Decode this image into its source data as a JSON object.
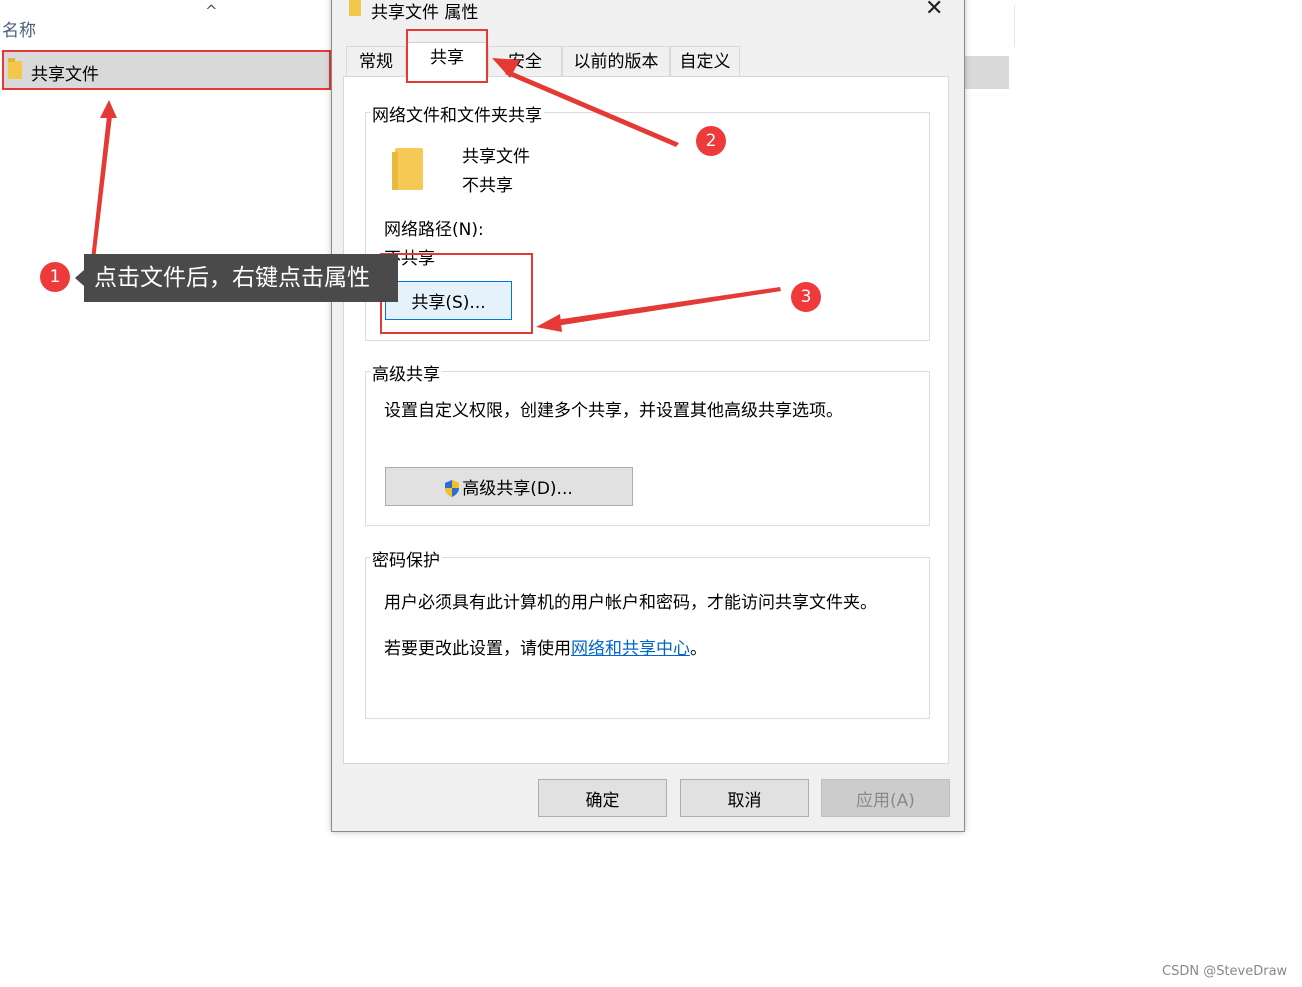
{
  "explorer": {
    "column_header": "名称",
    "file_name": "共享文件"
  },
  "dialog": {
    "title": "共享文件 属性",
    "tabs": [
      {
        "label": "常规"
      },
      {
        "label": "共享"
      },
      {
        "label": "安全"
      },
      {
        "label": "以前的版本"
      },
      {
        "label": "自定义"
      }
    ],
    "network_sharing": {
      "group_title": "网络文件和文件夹共享",
      "folder_name": "共享文件",
      "share_status": "不共享",
      "path_label": "网络路径(N):",
      "path_value": "不共享",
      "share_button": "共享(S)..."
    },
    "advanced_sharing": {
      "group_title": "高级共享",
      "description": "设置自定义权限，创建多个共享，并设置其他高级共享选项。",
      "button": "高级共享(D)..."
    },
    "password_protection": {
      "group_title": "密码保护",
      "line1": "用户必须具有此计算机的用户帐户和密码，才能访问共享文件夹。",
      "line2_prefix": "若要更改此设置，请使用",
      "link": "网络和共享中心",
      "line2_suffix": "。"
    },
    "buttons": {
      "ok": "确定",
      "cancel": "取消",
      "apply": "应用(A)"
    }
  },
  "annotations": {
    "step1": "1",
    "step2": "2",
    "step3": "3",
    "tooltip": "点击文件后，右键点击属性"
  },
  "watermark": "CSDN @SteveDraw",
  "colors": {
    "annotation_red": "#e53935",
    "badge_red": "#ee3a3a",
    "folder_yellow": "#f3c64c",
    "link_blue": "#0066cc"
  }
}
